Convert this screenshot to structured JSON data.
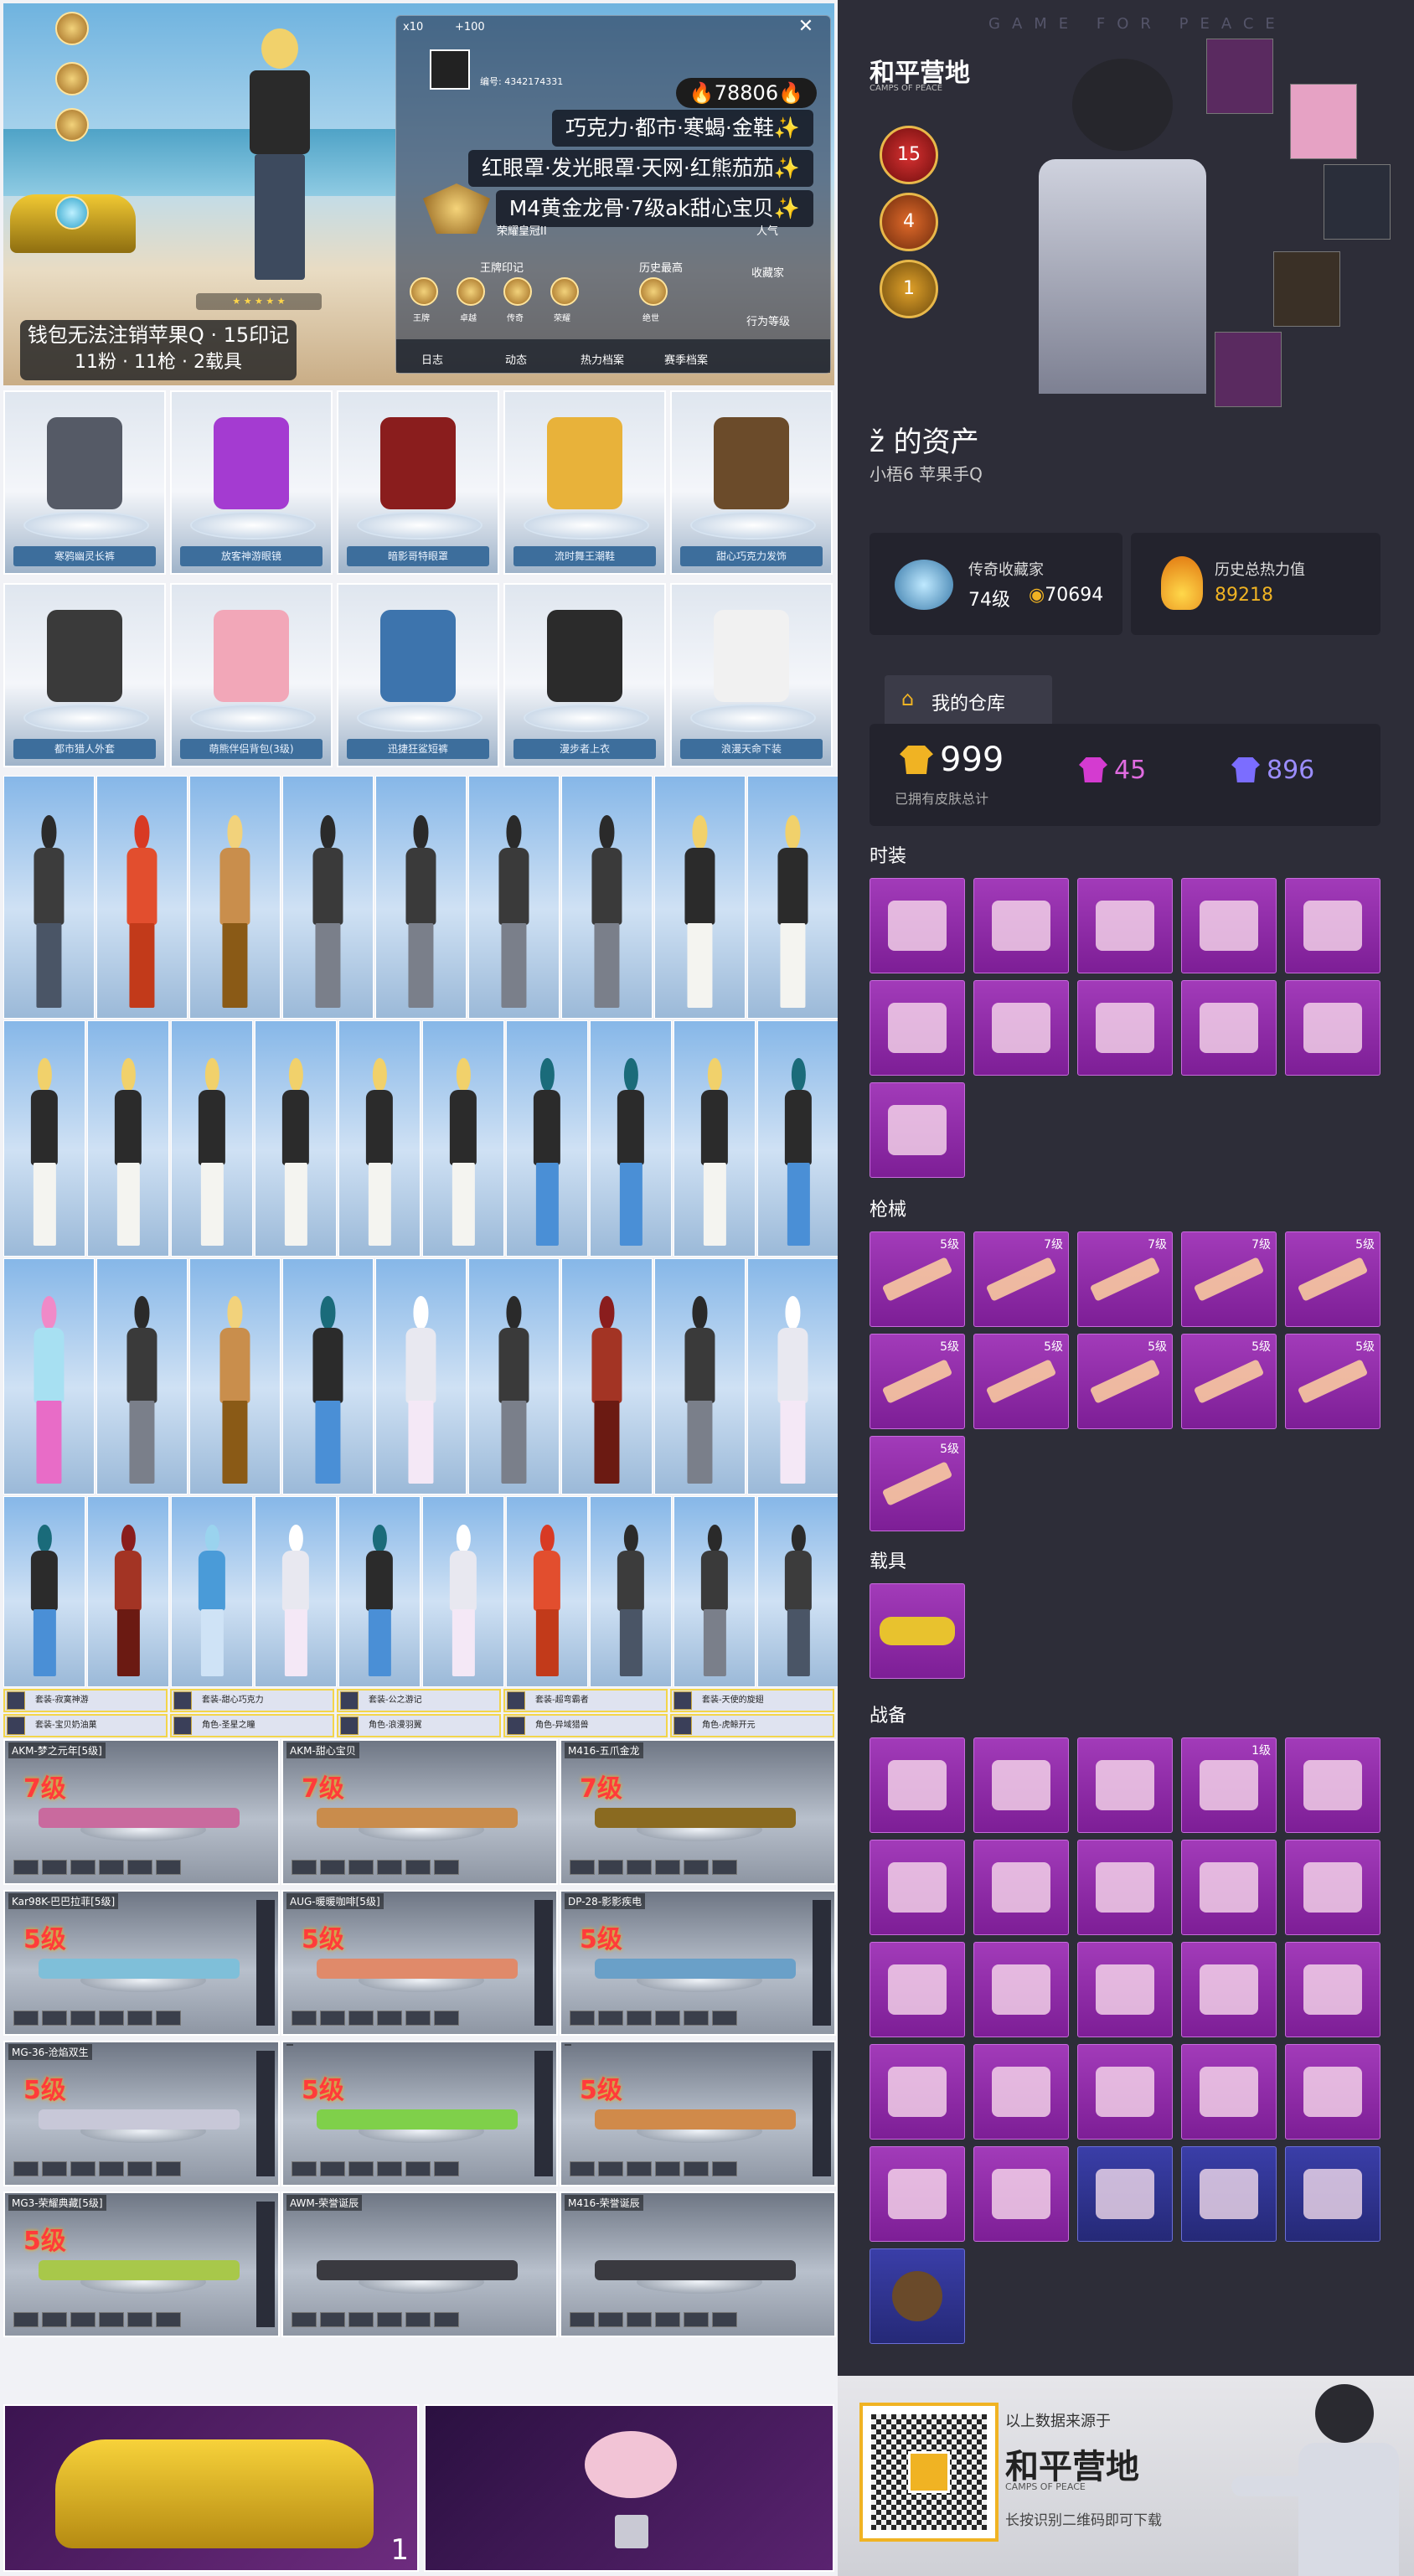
{
  "profile": {
    "wallet_note_line1": "钱包无法注销苹果Q · 15印记",
    "wallet_note_line2": "11粉 · 11枪 · 2载具",
    "heat_value": "78806",
    "tags": [
      "巧克力·都市·寒蝎·金鞋✨",
      "红眼罩·发光眼罩·天网·红熊茄茄✨",
      "M4黄金龙骨·7级ak甜心宝贝✨"
    ],
    "id_text": "编号: 4342174331",
    "glory_label": "荣耀皇冠II",
    "king_label": "王牌印记",
    "history_label": "历史最高",
    "popularity_label": "人气",
    "behaviour_label": "行为等级",
    "collect_label": "收藏家",
    "mini_icons": [
      "王牌",
      "卓越",
      "传奇",
      "荣耀",
      "绝世"
    ],
    "bottom_tabs": [
      "日志",
      "动态",
      "热力档案",
      "赛季档案"
    ],
    "close_icon": "✕",
    "kills_text": "x10",
    "level_text": "+100"
  },
  "outfits_row1": [
    "寒鸦幽灵长裤",
    "放客神游眼镜",
    "暗影哥特眼罩",
    "流时舞王潮鞋",
    "甜心巧克力发饰"
  ],
  "outfits_row2": [
    "都市猎人外套",
    "萌熊伴侣背包(3级)",
    "迅捷狂鲨短裤",
    "漫步者上衣",
    "浪漫天命下装"
  ],
  "sets_row1": [
    "套装-寂寞神游",
    "套装-甜心巧克力",
    "套装-公之游记",
    "套装-超弯霸者",
    "套装-天使的旋翅"
  ],
  "sets_row2": [
    "套装-宝贝奶油菓",
    "角色-圣星之瞳",
    "角色-浪漫羽翼",
    "角色-异域猎兽",
    "角色-虎鲸开元"
  ],
  "guns": [
    {
      "title": "AKM-梦之元年[5级]",
      "level": "7级"
    },
    {
      "title": "AKM-甜心宝贝",
      "level": "7级"
    },
    {
      "title": "M416-五爪金龙",
      "level": "7级"
    },
    {
      "title": "Kar98K-巴巴拉菲[5级]",
      "level": "5级"
    },
    {
      "title": "AUG-暖暖咖啡[5级]",
      "level": "5级"
    },
    {
      "title": "DP-28-影影疾电",
      "level": "5级"
    },
    {
      "title": "MG-36-沧焰双生",
      "level": "5级"
    },
    {
      "title": "",
      "level": "5级"
    },
    {
      "title": "",
      "level": "5级"
    },
    {
      "title": "MG3-荣耀典藏[5级]",
      "level": "5级"
    },
    {
      "title": "AWM-荣誉诞辰",
      "level": ""
    },
    {
      "title": "M416-荣誉诞辰",
      "level": ""
    }
  ],
  "promo_count": "1",
  "right": {
    "watermark": "GAME FOR PEACE",
    "logo_cn": "和平营地",
    "logo_en": "CAMPS OF PEACE",
    "assets_title": "的资产",
    "account_line": "小梧6  苹果手Q",
    "collector_label": "传奇收藏家",
    "collector_level": "74级",
    "collector_points": "70694",
    "heat_label": "历史总热力值",
    "heat_value": "89218",
    "warehouse_label": "我的仓库",
    "skins_total": "999",
    "skins_total_label": "已拥有皮肤总计",
    "legend_count": "45",
    "epic_count": "896",
    "sec_fashion": "时装",
    "sec_guns": "枪械",
    "sec_vehicles": "载具",
    "sec_gear": "战备",
    "gun_levels": [
      "5级",
      "7级",
      "7级",
      "7级",
      "5级",
      "5级",
      "5级",
      "5级",
      "5级",
      "5级",
      "5级"
    ],
    "gear_levels": [
      "",
      "",
      "",
      "1级",
      ""
    ],
    "footer_source": "以上数据来源于",
    "footer_logo": "和平营地",
    "footer_logo_en": "CAMPS OF PEACE",
    "footer_hint": "长按识别二维码即可下载",
    "rank_badges": [
      "15",
      "4",
      "1"
    ]
  },
  "colors": {
    "accent_purple": "#9b2fb5",
    "gold": "#f0b323",
    "dark_bg": "#2d2d38"
  }
}
